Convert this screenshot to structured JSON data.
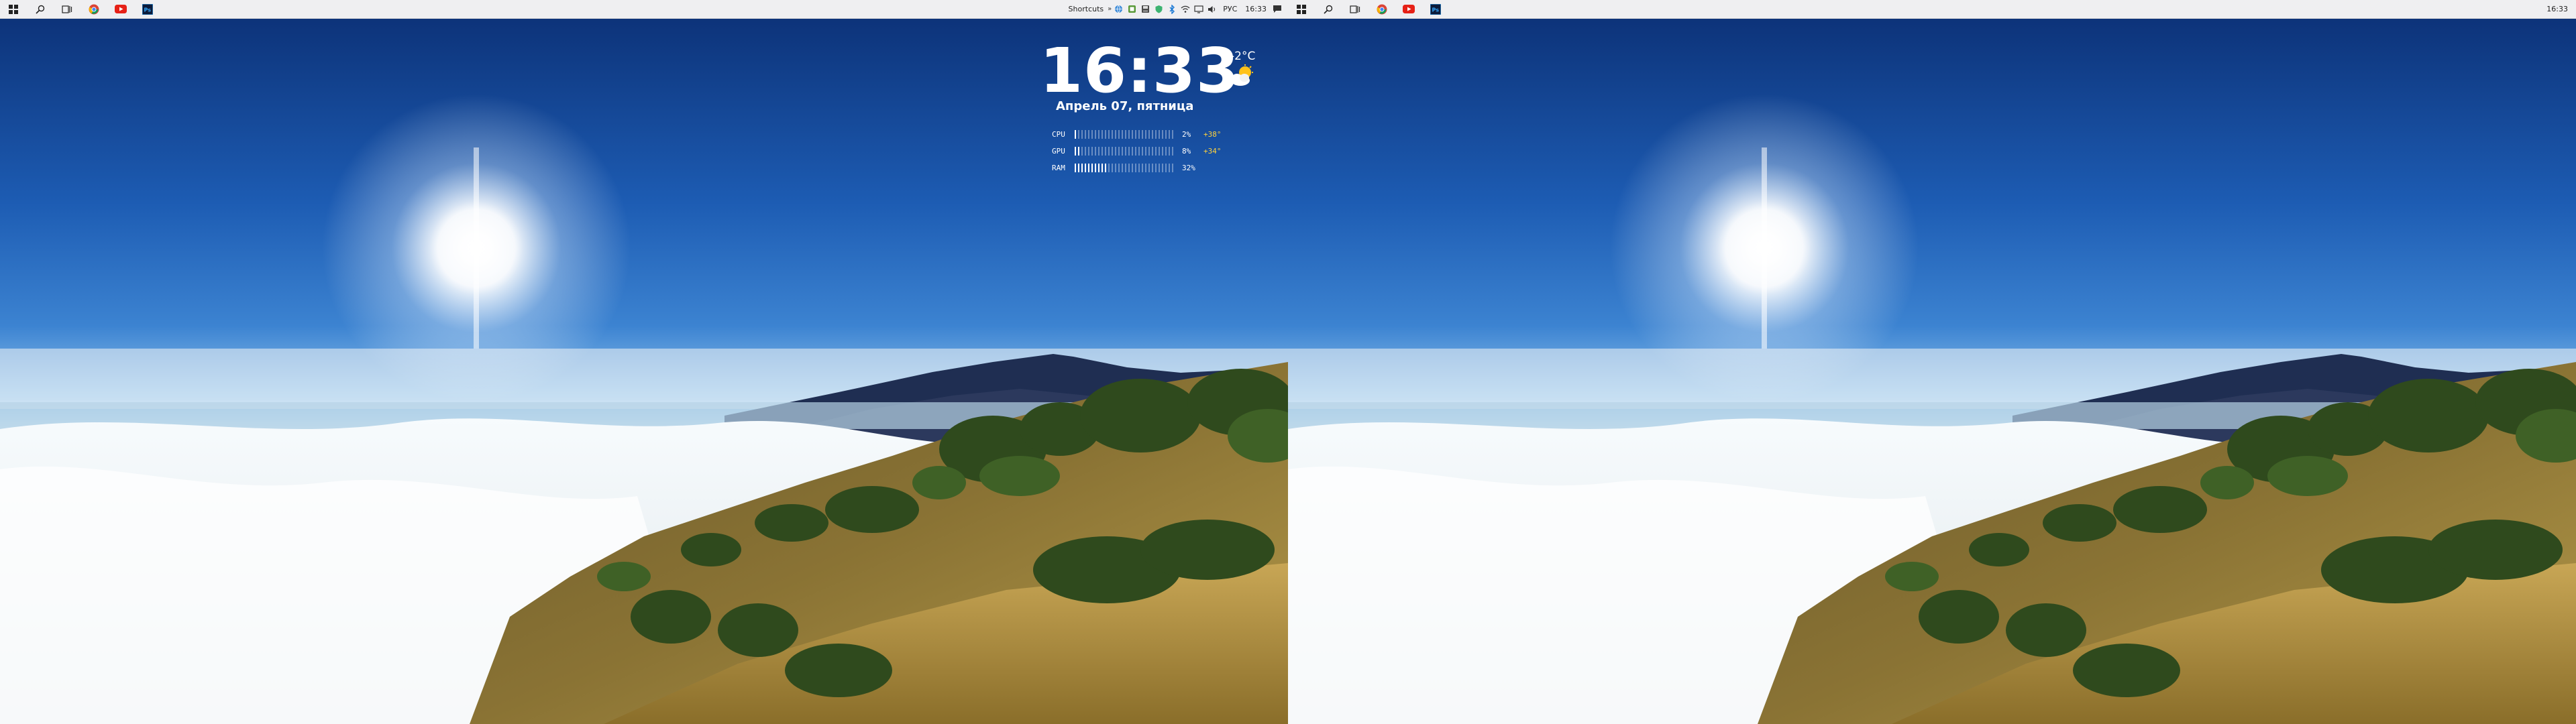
{
  "monitors": [
    {
      "taskbar": {
        "pinned": [
          {
            "name": "windows-start-icon"
          },
          {
            "name": "search-icon"
          },
          {
            "name": "task-view-icon"
          },
          {
            "name": "chrome-icon"
          },
          {
            "name": "youtube-icon"
          },
          {
            "name": "photoshop-icon"
          }
        ],
        "tray": {
          "shortcuts_label": "Shortcuts",
          "language": "РУС",
          "time": "16:33"
        }
      },
      "widget": {
        "time": "16:33",
        "date": "Апрель 07, пятница",
        "weather_temp": "-2°C",
        "weather_icon": "partly-sunny-icon",
        "stats": [
          {
            "label": "CPU",
            "value": "2%",
            "temp": "+38°",
            "percent": 2
          },
          {
            "label": "GPU",
            "value": "8%",
            "temp": "+34°",
            "percent": 8
          },
          {
            "label": "RAM",
            "value": "32%",
            "percent": 32
          }
        ]
      }
    },
    {
      "taskbar": {
        "pinned": [
          {
            "name": "windows-start-icon"
          },
          {
            "name": "search-icon"
          },
          {
            "name": "task-view-icon"
          },
          {
            "name": "chrome-icon"
          },
          {
            "name": "youtube-icon"
          },
          {
            "name": "photoshop-icon"
          }
        ],
        "tray": {
          "time": "16:33"
        }
      }
    }
  ],
  "colors": {
    "taskbar_bg": "#efeff1",
    "sky_top": "#0d3a86",
    "sky_bottom": "#6fb4ea",
    "temp_accent": "#ffd23c"
  }
}
